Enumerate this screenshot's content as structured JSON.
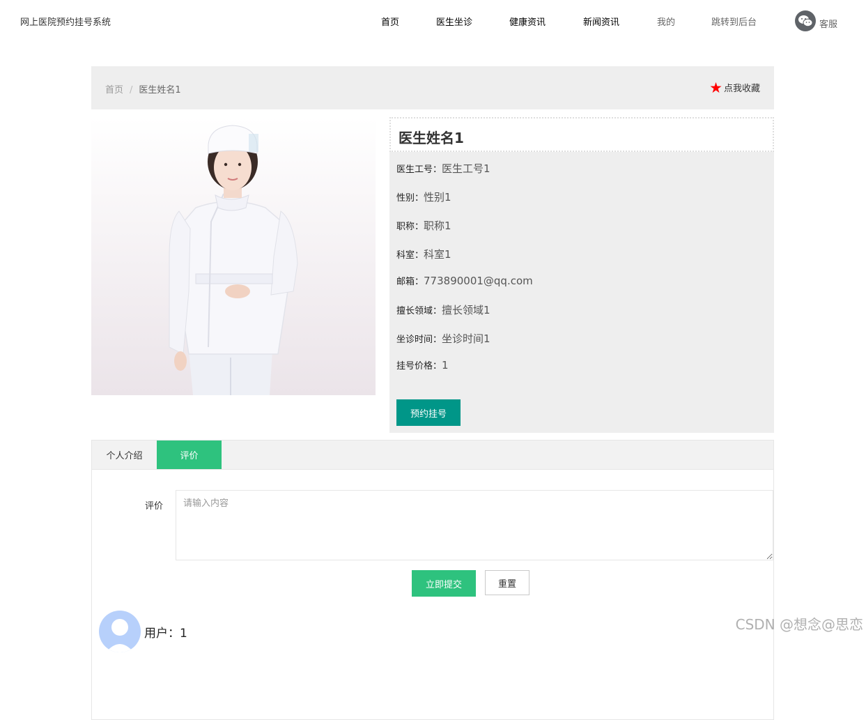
{
  "site": {
    "title": "网上医院预约挂号系统"
  },
  "nav": {
    "items": [
      "首页",
      "医生坐诊",
      "健康资讯",
      "新闻资讯",
      "我的",
      "跳转到后台"
    ],
    "service_label": "客服"
  },
  "breadcrumb": {
    "home": "首页",
    "separator": "/",
    "current": "医生姓名1"
  },
  "favorite": {
    "label": "点我收藏"
  },
  "doctor": {
    "name": "医生姓名1",
    "fields": [
      {
        "label": "医生工号：",
        "value": "医生工号1"
      },
      {
        "label": "性别：",
        "value": "性别1"
      },
      {
        "label": "职称：",
        "value": "职称1"
      },
      {
        "label": "科室：",
        "value": "科室1"
      },
      {
        "label": "邮箱：",
        "value": "773890001@qq.com"
      },
      {
        "label": "擅长领域：",
        "value": "擅长领域1"
      },
      {
        "label": "坐诊时间：",
        "value": "坐诊时间1"
      },
      {
        "label": "挂号价格：",
        "value": "1"
      }
    ],
    "book_button": "预约挂号"
  },
  "tabs": {
    "items": [
      "个人介绍",
      "评价"
    ],
    "active": 1
  },
  "review": {
    "label": "评价",
    "placeholder": "请输入内容",
    "submit": "立即提交",
    "reset": "重置"
  },
  "comments": [
    {
      "user": "用户：1"
    }
  ],
  "watermark": "CSDN @想念@思恋",
  "colors": {
    "primary_teal": "#009688",
    "accent_green": "#2ec27e",
    "favorite_star": "#ff0000",
    "panel_bg": "#eeeeee"
  }
}
